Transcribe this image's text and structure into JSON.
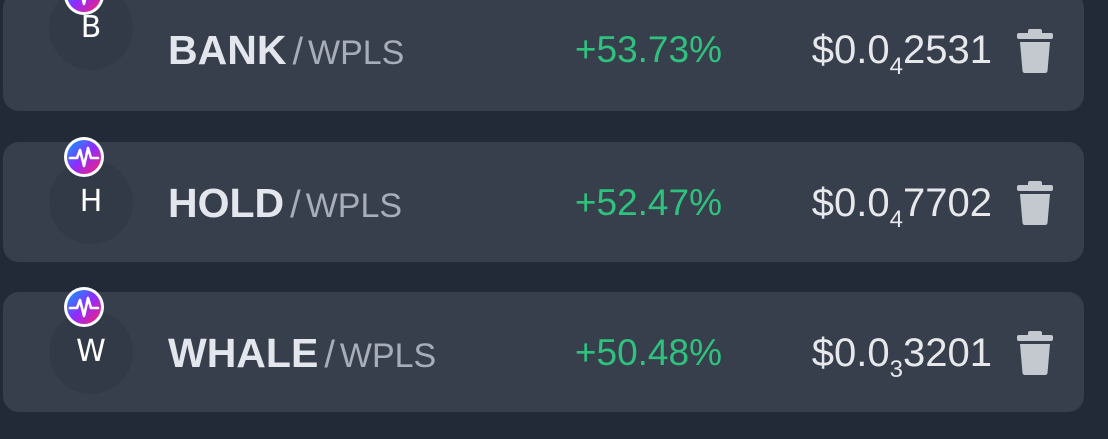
{
  "watchlist": {
    "rows": [
      {
        "avatar_letter": "B",
        "symbol": "BANK",
        "separator": "/",
        "quote": "WPLS",
        "change": "+53.73%",
        "price_prefix": "$0.0",
        "price_zero_count": "4",
        "price_digits": "2531",
        "chain_icon": "pulsechain-icon",
        "delete_icon": "trash-icon"
      },
      {
        "avatar_letter": "H",
        "symbol": "HOLD",
        "separator": "/",
        "quote": "WPLS",
        "change": "+52.47%",
        "price_prefix": "$0.0",
        "price_zero_count": "4",
        "price_digits": "7702",
        "chain_icon": "pulsechain-icon",
        "delete_icon": "trash-icon"
      },
      {
        "avatar_letter": "W",
        "symbol": "WHALE",
        "separator": "/",
        "quote": "WPLS",
        "change": "+50.48%",
        "price_prefix": "$0.0",
        "price_zero_count": "3",
        "price_digits": "3201",
        "chain_icon": "pulsechain-icon",
        "delete_icon": "trash-icon"
      }
    ]
  },
  "colors": {
    "background": "#222a38",
    "card": "#383f4c",
    "positive": "#2ec27e",
    "symbol_text": "#e3e6ec",
    "quote_text": "#a8aeb9",
    "icon": "#c4c8cf"
  }
}
